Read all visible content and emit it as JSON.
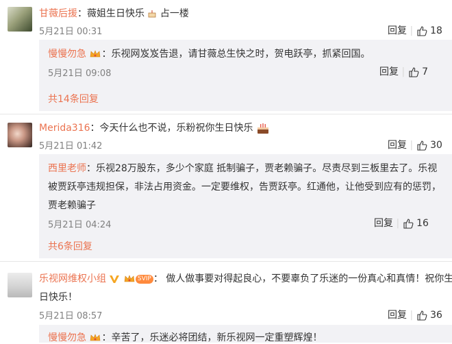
{
  "actions": {
    "reply_label": "回复"
  },
  "comments": [
    {
      "user": "甘薇后援",
      "text": "薇姐生日快乐",
      "text_suffix": "占一楼",
      "time": "5月21日 00:31",
      "likes": "18",
      "replies": [
        {
          "user": "慢慢勿急",
          "text": "乐视网岌岌告退，请甘薇总生快之时，贺电跃亭，抓紧回国。",
          "time": "5月21日 09:08",
          "likes": "7"
        }
      ],
      "more_replies": "共14条回复"
    },
    {
      "user": "Merida316",
      "text": "今天什么也不说，乐粉祝你生日快乐",
      "time": "5月21日 01:42",
      "likes": "30",
      "replies": [
        {
          "user": "西里老师",
          "text_lines": [
            "乐视28万股东，多少个家庭 抵制骗子，贾老赖骗子。尽责尽到三板里去了。乐视",
            "被贾跃亭违规担保，非法占用资金。一定要维权，告贾跃亭。红通他，让他受到应有的惩罚，",
            "贾老赖骗子"
          ],
          "time": "5月21日 04:24",
          "likes": "16"
        }
      ],
      "more_replies": "共6条回复"
    },
    {
      "user": "乐视网维权小组",
      "badge": "SVIP",
      "text_lines": [
        "做人做事要对得起良心，不要辜负了乐迷的一份真心和真情！祝你生",
        "日快乐！"
      ],
      "time": "5月21日 08:57",
      "likes": "36",
      "replies": [
        {
          "user": "慢慢勿急",
          "text": "辛苦了，乐迷必将团结，新乐视网一定重塑辉煌！"
        }
      ]
    }
  ],
  "colors": {
    "username": "#eb7350",
    "reply_bg": "#f2f2f5",
    "time": "#808080"
  }
}
